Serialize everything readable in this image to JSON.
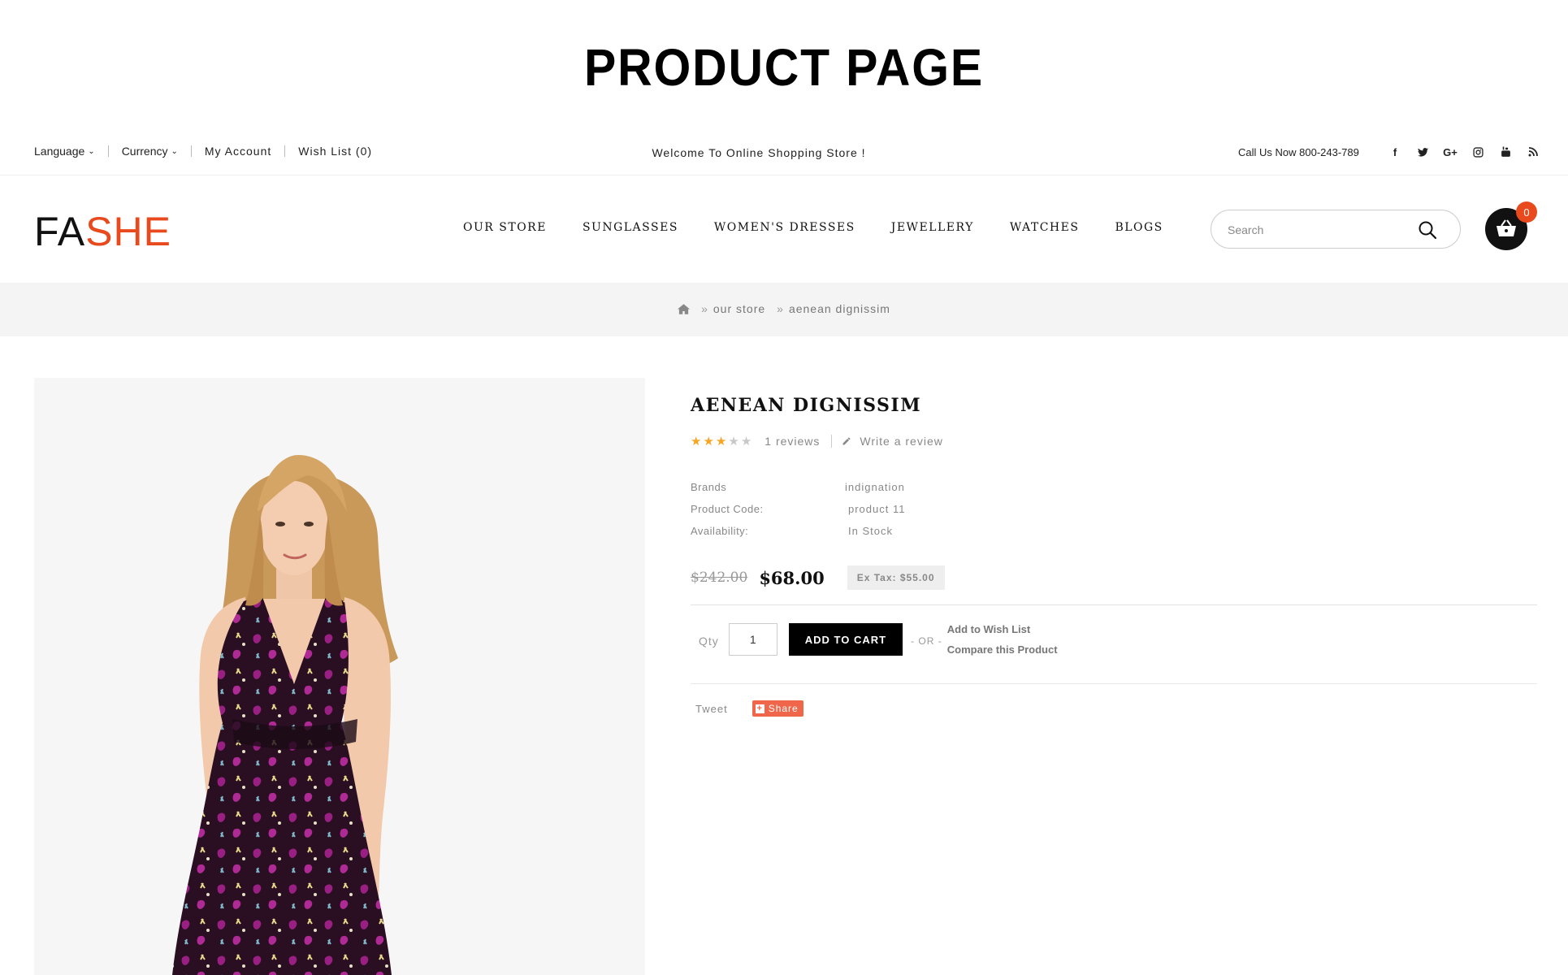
{
  "page_heading": "PRODUCT PAGE",
  "topbar": {
    "language": "Language",
    "currency": "Currency",
    "my_account": "My Account",
    "wish_list": "Wish List (0)",
    "welcome": "Welcome To Online Shopping Store !",
    "call": "Call Us Now 800-243-789",
    "socials": [
      "facebook-icon",
      "twitter-icon",
      "google-plus-icon",
      "instagram-icon",
      "youtube-icon",
      "rss-icon"
    ]
  },
  "header": {
    "logo_part1": "FA",
    "logo_part2": "SHE",
    "nav": [
      "OUR STORE",
      "SUNGLASSES",
      "WOMEN'S DRESSES",
      "JEWELLERY",
      "WATCHES",
      "BLOGS"
    ],
    "search_placeholder": "Search",
    "cart_count": "0"
  },
  "breadcrumb": {
    "home_icon": "home-icon",
    "items": [
      "our store",
      "aenean dignissim"
    ]
  },
  "product": {
    "title": "AENEAN DIGNISSIM",
    "rating": 3,
    "rating_max": 5,
    "reviews": "1 reviews",
    "write_review": "Write a review",
    "info": [
      {
        "label": "Brands",
        "value": "indignation"
      },
      {
        "label": "Product Code:",
        "value": "product 11"
      },
      {
        "label": "Availability:",
        "value": "In Stock"
      }
    ],
    "old_price": "$242.00",
    "new_price": "$68.00",
    "ex_tax": "Ex Tax: $55.00",
    "qty_label": "Qty",
    "qty_value": "1",
    "add_to_cart": "ADD TO CART",
    "or_label": "- OR -",
    "add_to_wish_list": "Add to Wish List",
    "compare": "Compare this Product",
    "tweet": "Tweet",
    "share": "Share"
  },
  "colors": {
    "accent": "#e8491d",
    "star_filled": "#f5a623",
    "star_empty": "#c8c8c8",
    "share": "#f0664a"
  }
}
